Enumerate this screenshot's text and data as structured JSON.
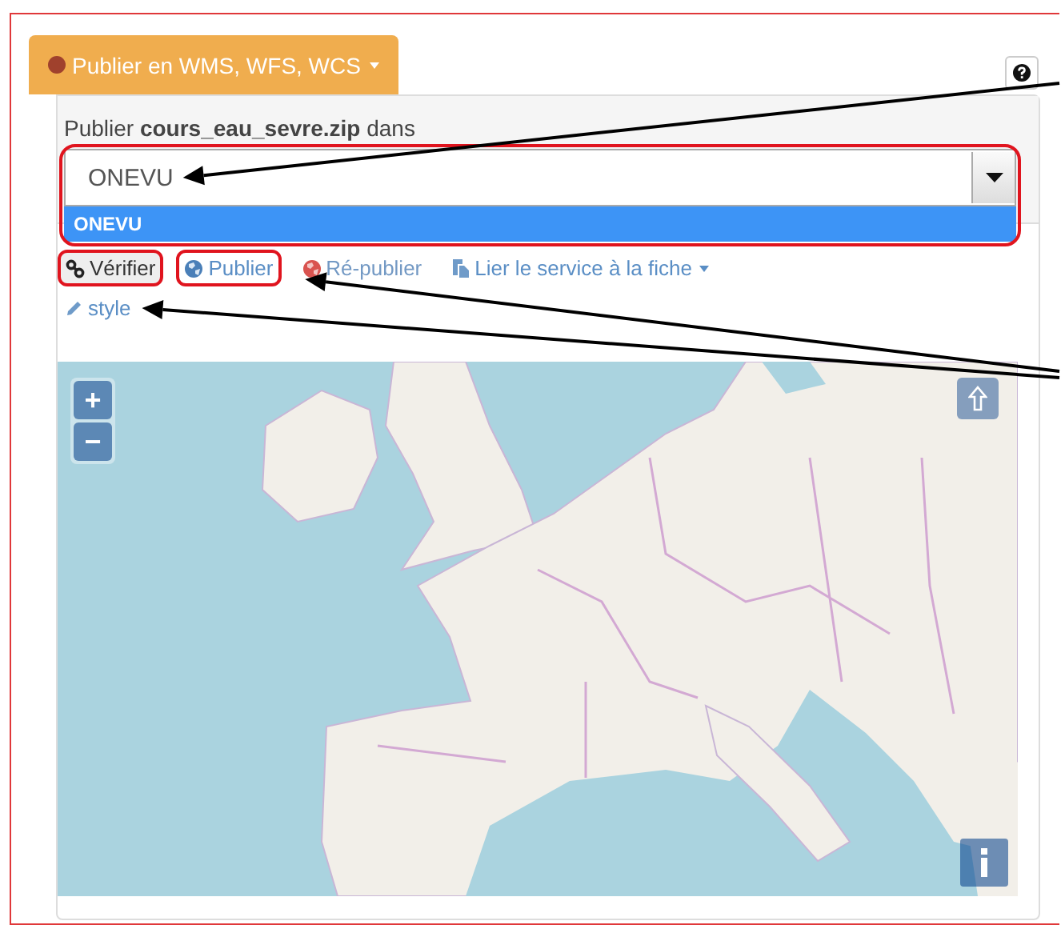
{
  "publish_menu": {
    "label": "Publier en WMS, WFS, WCS"
  },
  "prompt": "Publier **cours_eau_sevre.zip** dans",
  "select": {
    "value": "ONEVU",
    "highlighted": true,
    "expanded": true,
    "options": [
      {
        "label": "ONEVU",
        "selected": true
      }
    ]
  },
  "actions": [
    {
      "kind": "button",
      "label": "Vérifier",
      "highlighted": true,
      "disabled": false,
      "has_menu": false
    },
    {
      "kind": "link",
      "label": "Publier",
      "highlighted": true,
      "disabled": false,
      "has_menu": false
    },
    {
      "kind": "link",
      "label": "Ré-publier",
      "highlighted": false,
      "disabled": true,
      "has_menu": false
    },
    {
      "kind": "link",
      "label": "Lier le service à la fiche",
      "highlighted": false,
      "disabled": false,
      "has_menu": true
    },
    {
      "kind": "link",
      "label": "style",
      "highlighted": false,
      "disabled": false,
      "has_menu": false
    }
  ],
  "map": {
    "kind": "picture",
    "zoom_in": "+",
    "zoom_out": "−"
  }
}
